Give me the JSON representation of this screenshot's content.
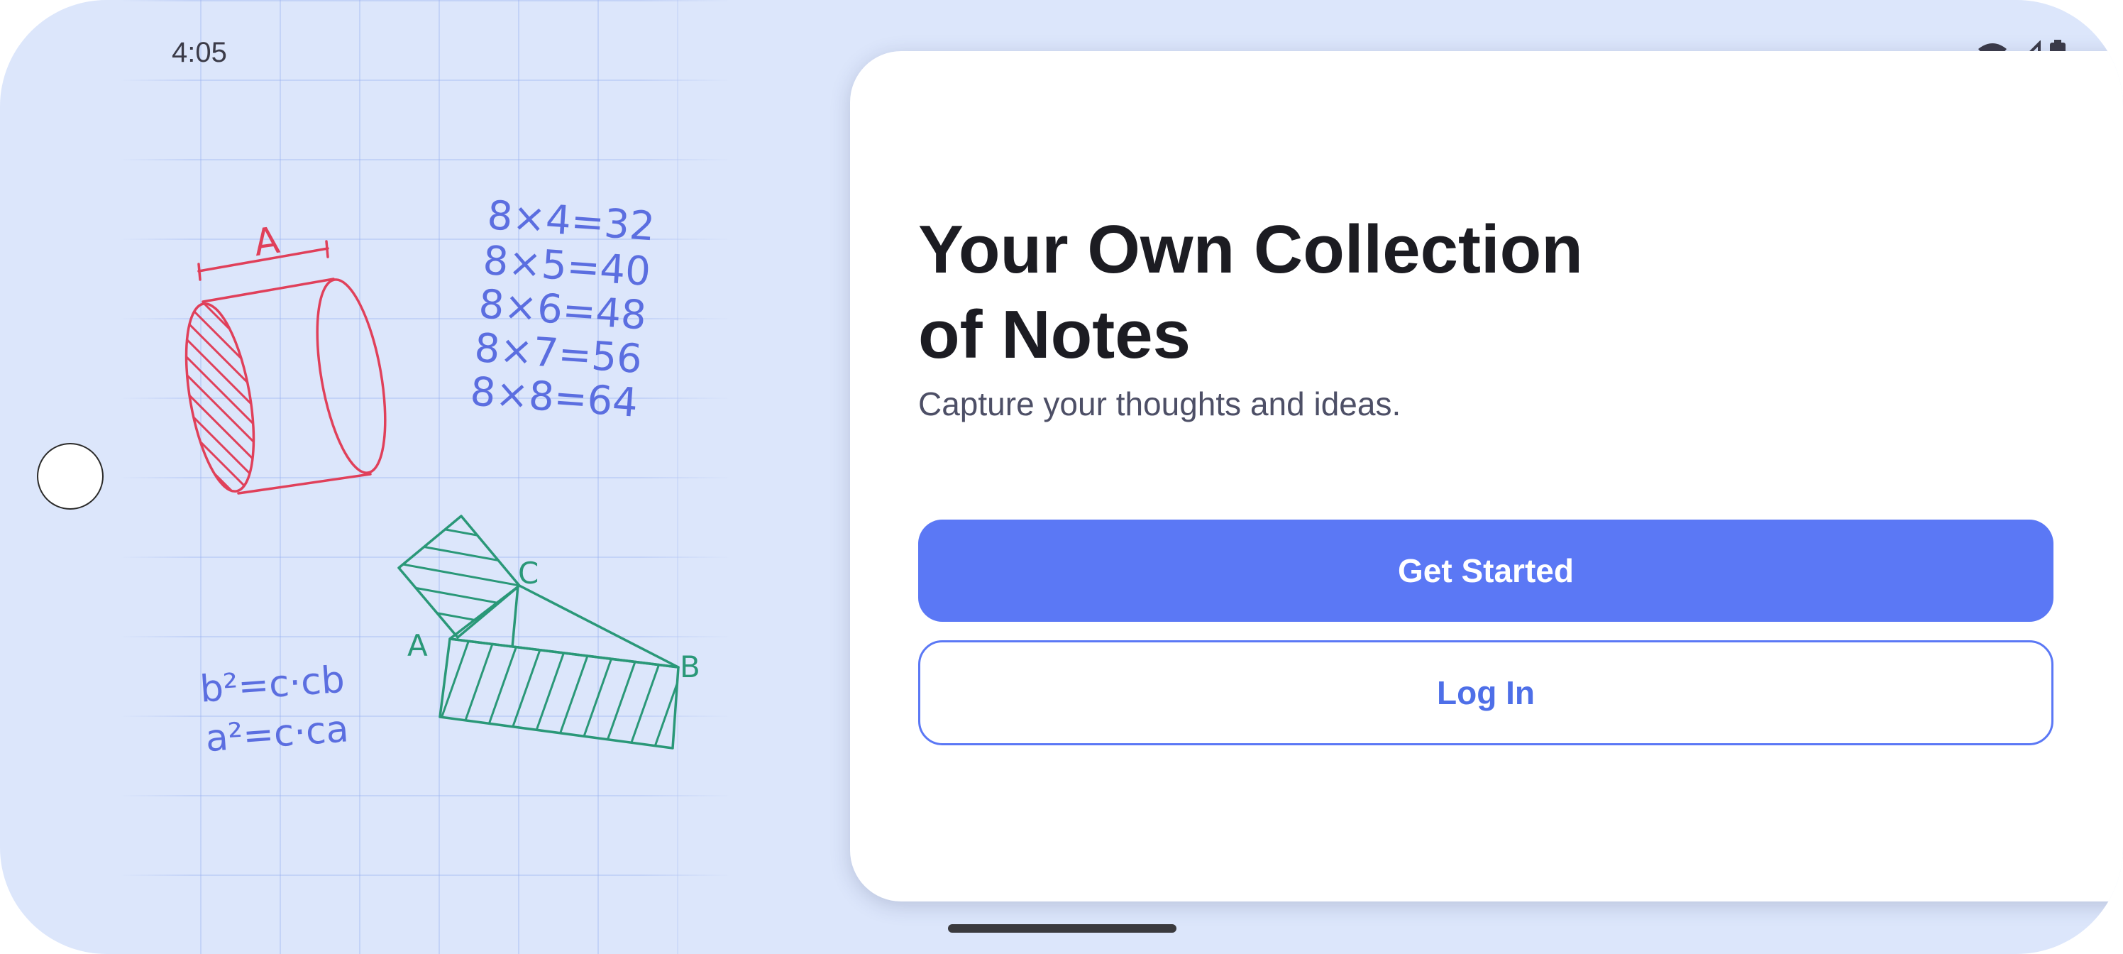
{
  "status_bar": {
    "time": "4:05",
    "icons": [
      "wifi-icon",
      "signal-icon",
      "battery-icon"
    ]
  },
  "onboarding": {
    "title_line1": "Your Own Collection",
    "title_line2": "of Notes",
    "subtitle": "Capture your thoughts and ideas.",
    "primary_button": "Get Started",
    "secondary_button": "Log In"
  },
  "illustration": {
    "cylinder_label": "A",
    "multiplication": [
      "8×4=32",
      "8×5=40",
      "8×6=48",
      "8×7=56",
      "8×8=64"
    ],
    "triangle_labels": [
      "C",
      "A",
      "B"
    ],
    "formulas": [
      "b²=c·cb",
      "a²=c·ca"
    ]
  },
  "colors": {
    "background": "#dce6fb",
    "accent": "#5b78f5",
    "ink_red": "#e0405a",
    "ink_blue": "#5b6ee0",
    "ink_green": "#2a9878"
  }
}
